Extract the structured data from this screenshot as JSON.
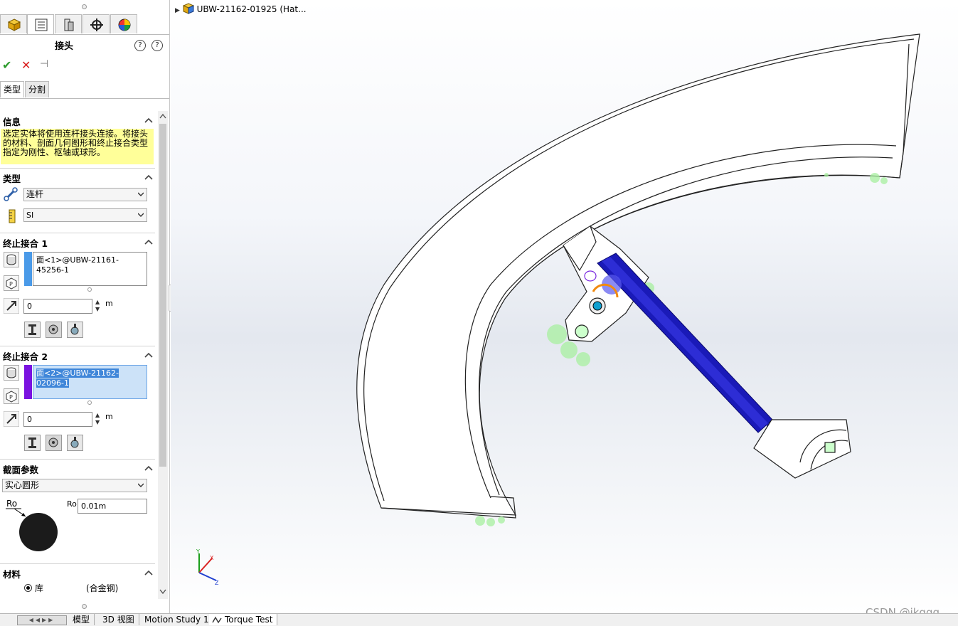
{
  "panel": {
    "manager_tabs": [
      {
        "name": "featuremanager-icon"
      },
      {
        "name": "propertymanager-icon"
      },
      {
        "name": "configurationmanager-icon"
      },
      {
        "name": "dimxpert-icon"
      },
      {
        "name": "displaymanager-icon"
      }
    ],
    "title": "接头",
    "ok_label": "✔",
    "cancel_label": "✕",
    "pin_label": "⊣",
    "subtabs": {
      "type": "类型",
      "split": "分割"
    },
    "info": {
      "heading": "信息",
      "text": "选定实体将使用连杆接头连接。将接头的材料、剖面几何图形和终止接合类型指定为刚性、枢轴或球形。"
    },
    "type_section": {
      "heading": "类型",
      "connector_type": "连杆",
      "unit_system": "SI"
    },
    "end1": {
      "heading": "终止接合 1",
      "face": "面<1>@UBW-21161-45256-1",
      "color": "#4a9ae8",
      "offset": "0",
      "unit": "m"
    },
    "end2": {
      "heading": "终止接合 2",
      "face": "面<2>@UBW-21162-02096-1",
      "color": "#7a12e0",
      "offset": "0",
      "unit": "m"
    },
    "section": {
      "heading": "截面参数",
      "shape": "实心圆形",
      "ro_label": "Ro",
      "ro_field_label": "Ro",
      "ro_value": "0.01m"
    },
    "material": {
      "heading": "材料",
      "library_label": "库",
      "material_name": "(合金钢)"
    }
  },
  "viewport": {
    "tree_root": "UBW-21162-01925 (Hat...",
    "watermark": "CSDN @jkggg",
    "triad": {
      "x": "X",
      "y": "Y",
      "z": "Z"
    }
  },
  "bottombar": {
    "tabs": [
      "模型",
      "3D 视图",
      "Motion Study 1",
      "Torque Test"
    ],
    "active": "Torque Test"
  }
}
